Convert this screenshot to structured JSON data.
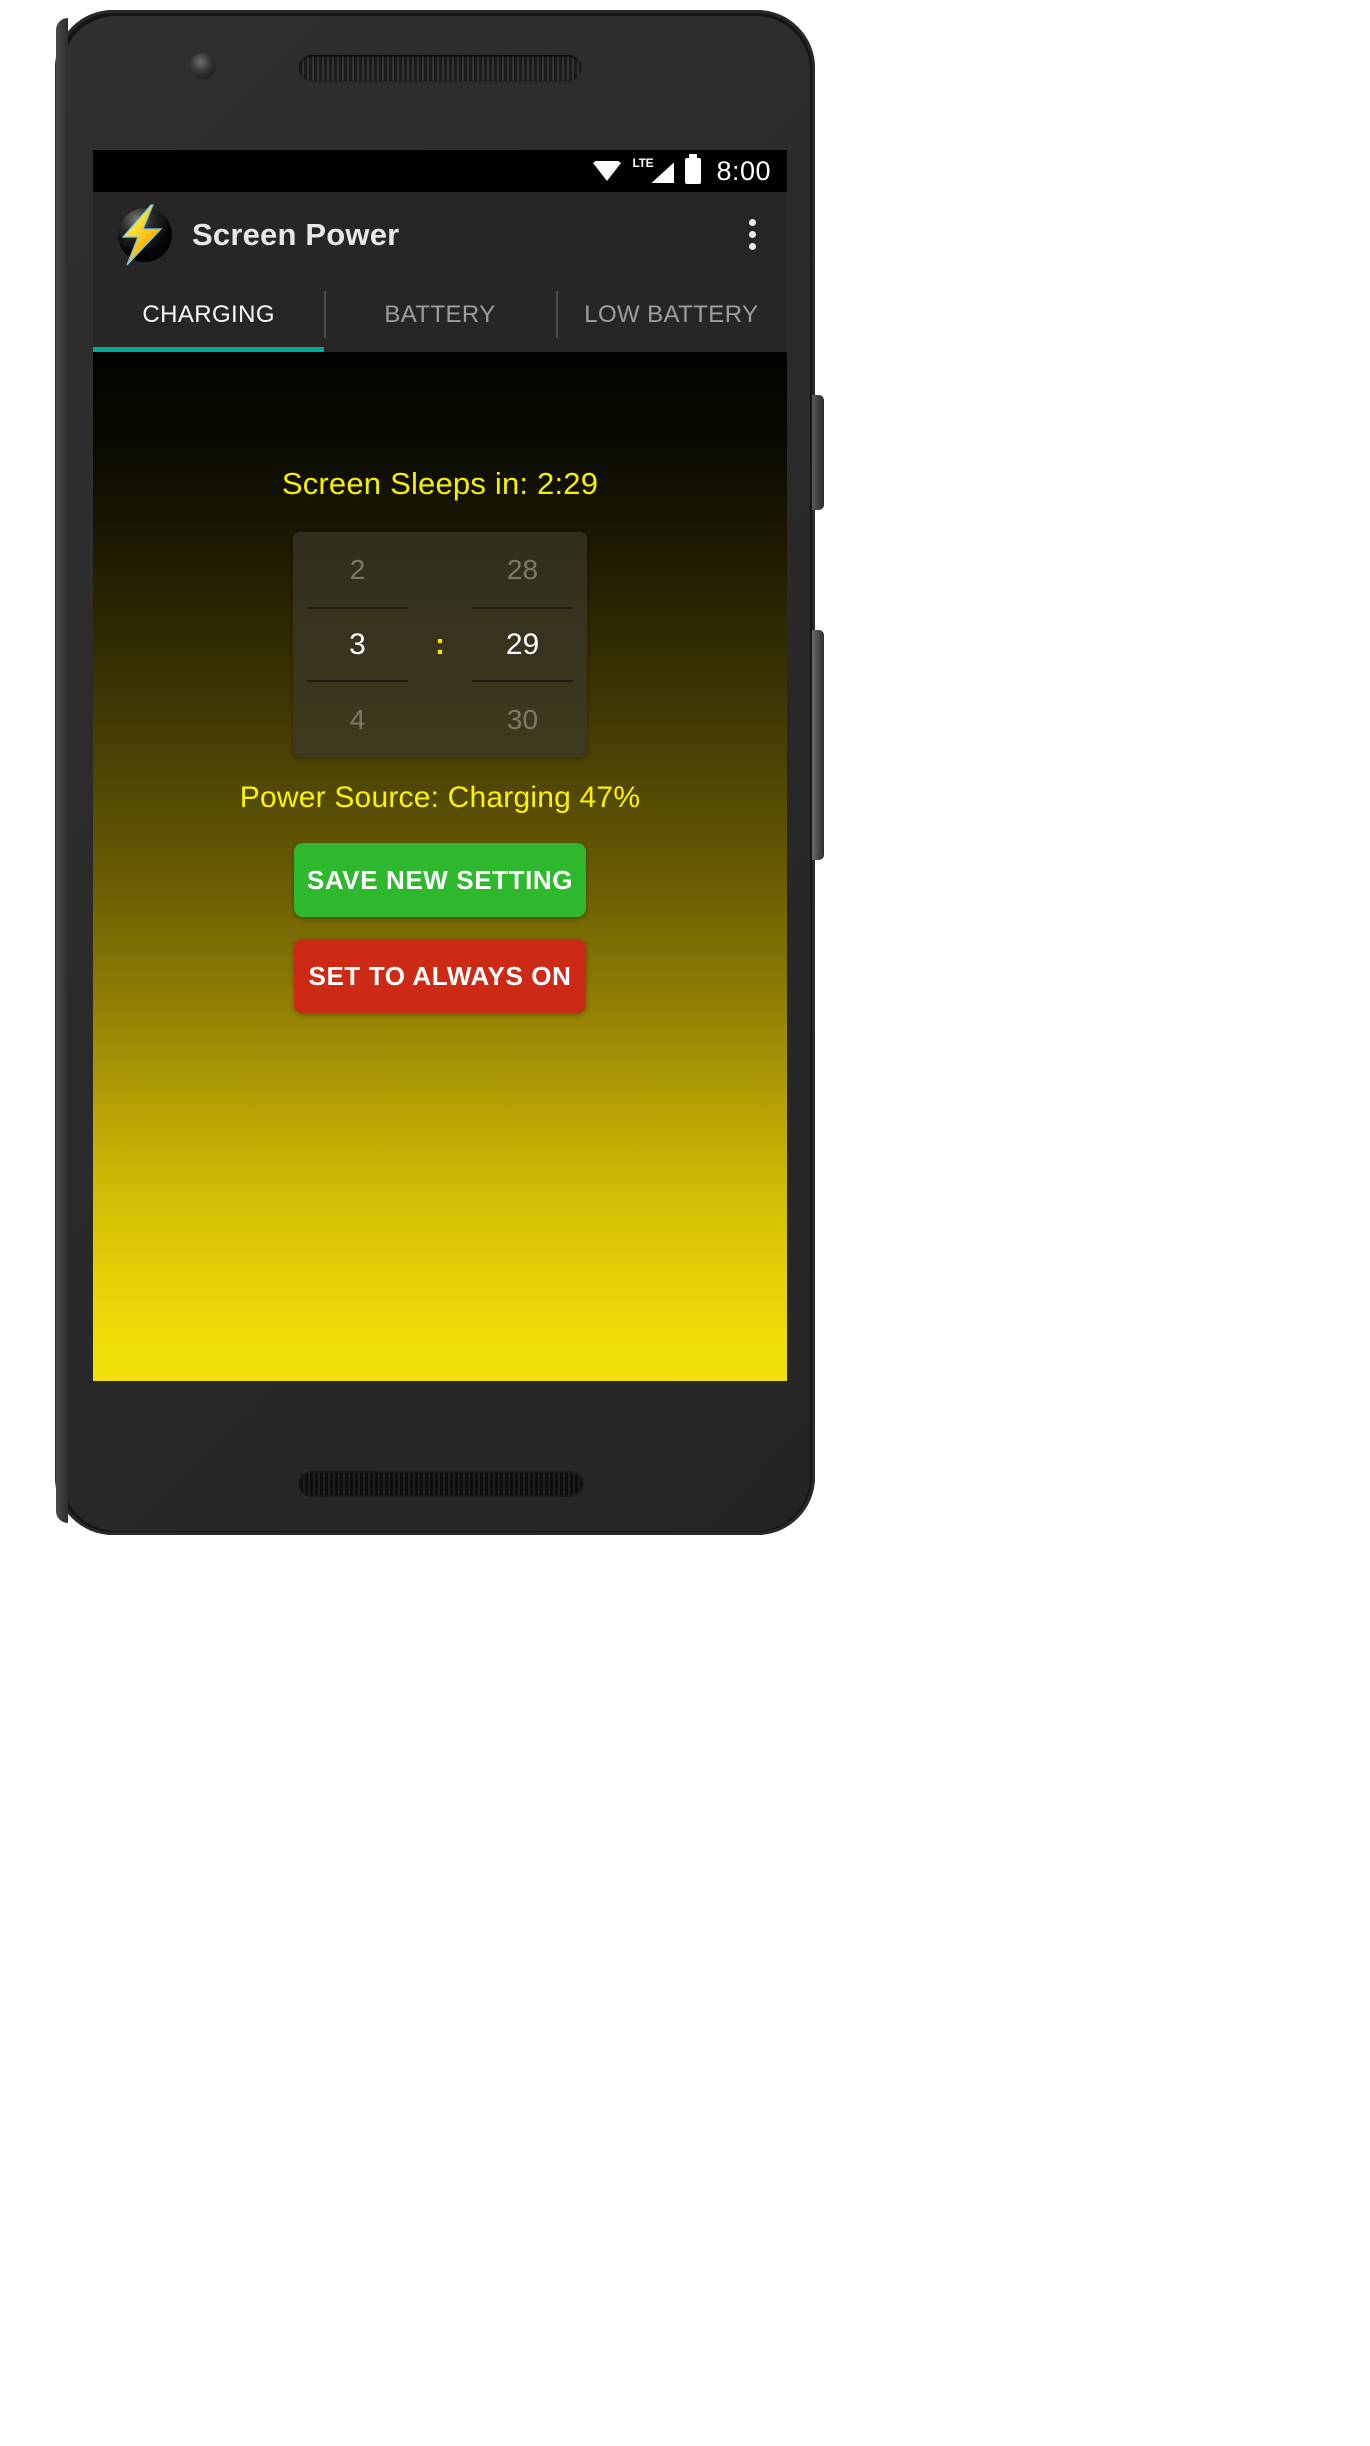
{
  "statusbar": {
    "time": "8:00",
    "network_label": "LTE",
    "icons": [
      "wifi-icon",
      "lte-signal-icon",
      "battery-icon"
    ]
  },
  "appbar": {
    "title": "Screen Power",
    "logo_icon": "lightning-bolt-icon",
    "overflow_icon": "overflow-menu-icon",
    "accent_color": "#00a98f",
    "background": "#262626"
  },
  "tabs": [
    {
      "label": "CHARGING",
      "active": true
    },
    {
      "label": "BATTERY",
      "active": false
    },
    {
      "label": "LOW BATTERY",
      "active": false
    }
  ],
  "content": {
    "sleeps_label": "Screen Sleeps in: 2:29",
    "power_source": "Power Source: Charging  47%",
    "text_color": "#f5f000",
    "gradient_top": "#020200",
    "gradient_bottom": "#f2e008"
  },
  "time_picker": {
    "hours": {
      "prev": "2",
      "current": "3",
      "next": "4"
    },
    "minutes": {
      "prev": "28",
      "current": "29",
      "next": "30"
    },
    "separator": ":"
  },
  "buttons": {
    "save": {
      "label": "SAVE NEW SETTING",
      "color": "#2db82d"
    },
    "always_on": {
      "label": "SET TO ALWAYS ON",
      "color": "#cc2a15"
    }
  },
  "navbar": {
    "back": "back-icon",
    "home": "home-icon",
    "recents": "recents-icon"
  }
}
